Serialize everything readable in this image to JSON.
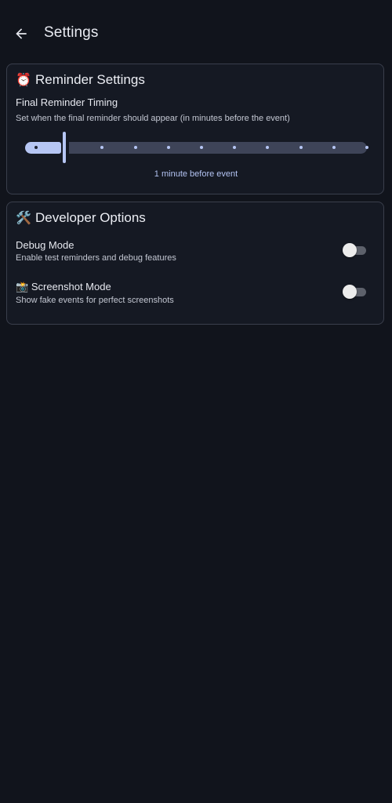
{
  "header": {
    "back_icon": "arrow-left-icon",
    "title": "Settings"
  },
  "reminder": {
    "emoji": "⏰",
    "title": "Reminder Settings",
    "timing_label": "Final Reminder Timing",
    "timing_description": "Set when the final reminder should appear (in minutes before the event)",
    "slider": {
      "value": 1,
      "min": 0,
      "max": 10,
      "step": 1,
      "value_text": "1 minute before event"
    }
  },
  "developer": {
    "emoji": "🛠️",
    "title": "Developer Options",
    "debug": {
      "label": "Debug Mode",
      "description": "Enable test reminders and debug features",
      "enabled": false
    },
    "screenshot": {
      "emoji": "📸",
      "label": "Screenshot Mode",
      "description": "Show fake events for perfect screenshots",
      "enabled": false
    }
  },
  "colors": {
    "background": "#11141c",
    "card": "#151923",
    "accent": "#b6c6f4",
    "track_inactive": "#3e4458"
  }
}
